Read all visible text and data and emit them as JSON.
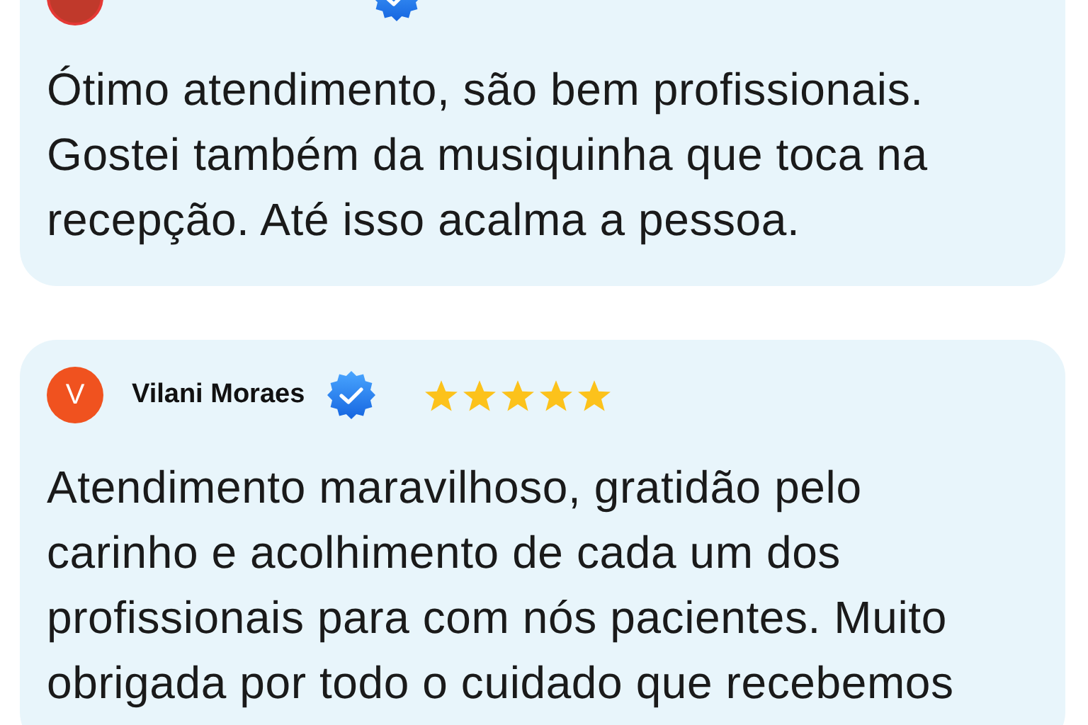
{
  "reviews": [
    {
      "avatar": {
        "kind": "photo"
      },
      "verified": true,
      "text": "Ótimo atendimento, são bem profissionais. Gostei também da musiquinha que toca na recepção. Até isso acalma a pessoa."
    },
    {
      "avatar": {
        "kind": "initial",
        "initial": "V",
        "color": "#f0521f"
      },
      "name": "Vilani Moraes",
      "verified": true,
      "stars": 5,
      "text": "Atendimento maravilhoso, gratidão pelo carinho e acolhimento de cada um dos profissionais para com nós pacientes. Muito obrigada por todo o cuidado que recebemos"
    }
  ]
}
